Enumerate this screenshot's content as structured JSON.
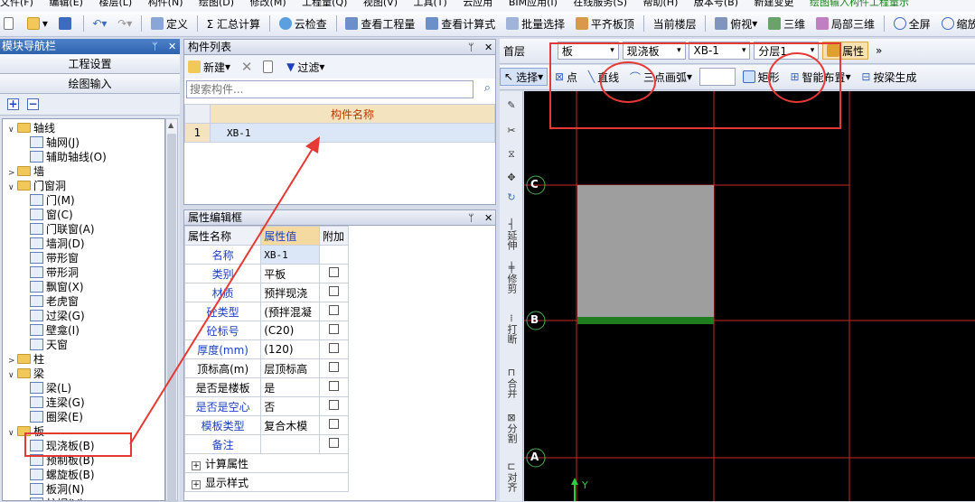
{
  "menubar": [
    "文件(F)",
    "编辑(E)",
    "楼层(L)",
    "构件(N)",
    "绘图(D)",
    "修改(M)",
    "工程量(Q)",
    "视图(V)",
    "工具(T)",
    "云应用",
    "BIM应用(I)",
    "在线服务(S)",
    "帮助(H)",
    "版本号(B)",
    "新建变更",
    "绘图输入构件工程量示"
  ],
  "toolbar1": {
    "define": "定义",
    "sum": "Σ 汇总计算",
    "cloud_check": "云检查",
    "view_qty": "查看工程量",
    "view_formula": "查看计算式",
    "batch_select": "批量选择",
    "align_top": "平齐板顶",
    "current_floor": "当前楼层",
    "top_view": "俯视",
    "three_d": "三维",
    "local_3d": "局部三维",
    "fullscreen": "全屏",
    "zoom": "缩放"
  },
  "nav": {
    "title": "模块导航栏",
    "btn_project": "工程设置",
    "btn_draw": "绘图输入",
    "tree": [
      {
        "label": "轴线",
        "level": 0,
        "exp": "∨",
        "type": "folder"
      },
      {
        "label": "轴网(J)",
        "level": 1,
        "type": "item"
      },
      {
        "label": "辅助轴线(O)",
        "level": 1,
        "type": "item"
      },
      {
        "label": "墙",
        "level": 0,
        "exp": ">",
        "type": "folder"
      },
      {
        "label": "门窗洞",
        "level": 0,
        "exp": "∨",
        "type": "folder"
      },
      {
        "label": "门(M)",
        "level": 1,
        "type": "item"
      },
      {
        "label": "窗(C)",
        "level": 1,
        "type": "item"
      },
      {
        "label": "门联窗(A)",
        "level": 1,
        "type": "item"
      },
      {
        "label": "墙洞(D)",
        "level": 1,
        "type": "item"
      },
      {
        "label": "带形窗",
        "level": 1,
        "type": "item"
      },
      {
        "label": "带形洞",
        "level": 1,
        "type": "item"
      },
      {
        "label": "飘窗(X)",
        "level": 1,
        "type": "item"
      },
      {
        "label": "老虎窗",
        "level": 1,
        "type": "item"
      },
      {
        "label": "过梁(G)",
        "level": 1,
        "type": "item"
      },
      {
        "label": "壁龛(I)",
        "level": 1,
        "type": "item"
      },
      {
        "label": "天窗",
        "level": 1,
        "type": "item"
      },
      {
        "label": "柱",
        "level": 0,
        "exp": ">",
        "type": "folder"
      },
      {
        "label": "梁",
        "level": 0,
        "exp": "∨",
        "type": "folder"
      },
      {
        "label": "梁(L)",
        "level": 1,
        "type": "item"
      },
      {
        "label": "连梁(G)",
        "level": 1,
        "type": "item"
      },
      {
        "label": "圈梁(E)",
        "level": 1,
        "type": "item"
      },
      {
        "label": "板",
        "level": 0,
        "exp": "∨",
        "type": "folder"
      },
      {
        "label": "现浇板(B)",
        "level": 1,
        "type": "item"
      },
      {
        "label": "预制板(B)",
        "level": 1,
        "type": "item"
      },
      {
        "label": "螺旋板(B)",
        "level": 1,
        "type": "item"
      },
      {
        "label": "板洞(N)",
        "level": 1,
        "type": "item"
      },
      {
        "label": "柱帽(V)",
        "level": 1,
        "type": "item"
      }
    ]
  },
  "component_list": {
    "title": "构件列表",
    "new_btn": "新建",
    "filter_btn": "过滤",
    "search_placeholder": "搜索构件...",
    "col_name": "构件名称",
    "rows": [
      {
        "index": "1",
        "name": "XB-1"
      }
    ]
  },
  "props": {
    "title": "属性编辑框",
    "col_name": "属性名称",
    "col_value": "属性值",
    "col_extra": "附加",
    "rows": [
      {
        "name": "名称",
        "value": "XB-1",
        "blue": true,
        "check": false
      },
      {
        "name": "类别",
        "value": "平板",
        "blue": true,
        "check": true
      },
      {
        "name": "材质",
        "value": "预拌现浇",
        "blue": true,
        "check": true
      },
      {
        "name": "砼类型",
        "value": "(预拌混凝",
        "blue": true,
        "check": true
      },
      {
        "name": "砼标号",
        "value": "(C20)",
        "blue": true,
        "check": true
      },
      {
        "name": "厚度(mm)",
        "value": "(120)",
        "blue": true,
        "check": true
      },
      {
        "name": "顶标高(m)",
        "value": "层顶标高",
        "blue": false,
        "check": true
      },
      {
        "name": "是否是楼板",
        "value": "是",
        "blue": false,
        "check": true
      },
      {
        "name": "是否是空心",
        "value": "否",
        "blue": true,
        "check": true
      },
      {
        "name": "模板类型",
        "value": "复合木模",
        "blue": true,
        "check": true
      },
      {
        "name": "备注",
        "value": "",
        "blue": true,
        "check": true
      }
    ],
    "groups": [
      "计算属性",
      "显示样式"
    ]
  },
  "toolbar2": {
    "floor": "首层",
    "type": "板",
    "subtype": "现浇板",
    "component": "XB-1",
    "layer": "分层1",
    "attributes": "属性"
  },
  "toolbar3": {
    "select": "选择",
    "point": "点",
    "line": "直线",
    "arc": "三点画弧",
    "rect": "矩形",
    "smart": "智能布置",
    "by_beam": "按梁生成"
  },
  "vtools": [
    "延伸",
    "修剪",
    "打断",
    "合并",
    "分割",
    "对齐"
  ],
  "canvas": {
    "axis_labels": [
      "C",
      "B",
      "A"
    ],
    "y_label": "Y"
  },
  "colors": {
    "accent": "#e53935",
    "canvas_bg": "#000000",
    "grid": "#d32f2f",
    "slab": "#9e9e9e",
    "slab_edge": "#1e7d1e"
  }
}
